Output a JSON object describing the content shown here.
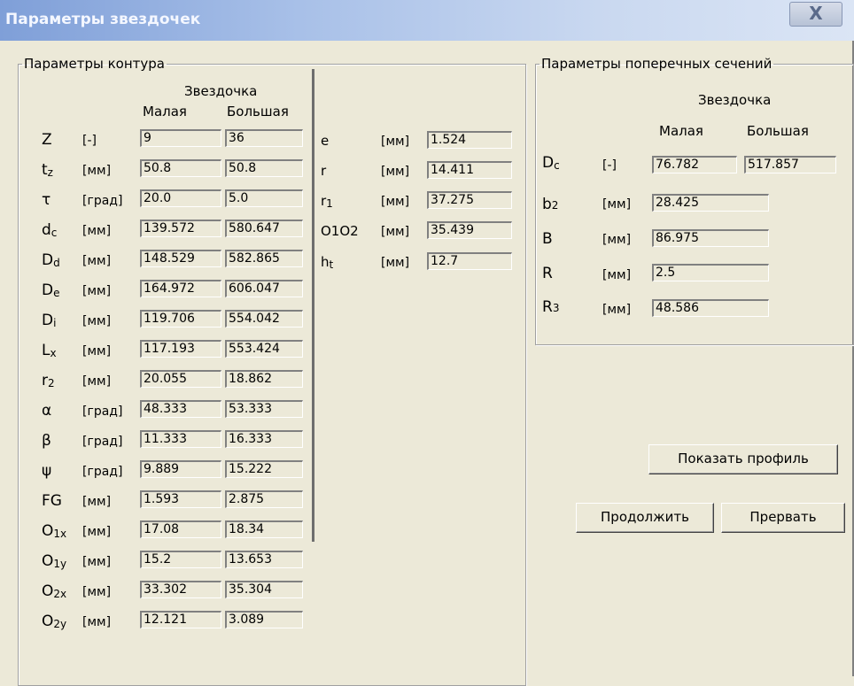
{
  "window": {
    "title": "Параметры звездочек",
    "close_label": "X"
  },
  "contour": {
    "legend": "Параметры контура",
    "header": {
      "group": "Звездочка",
      "small": "Малая",
      "large": "Большая"
    },
    "rows": [
      {
        "sym": "Z",
        "sub": "",
        "unit": "[-]",
        "small": "9",
        "large": "36"
      },
      {
        "sym": "t",
        "sub": "z",
        "unit": "[мм]",
        "small": "50.8",
        "large": "50.8"
      },
      {
        "sym": "τ",
        "sub": "",
        "unit": "[град]",
        "small": "20.0",
        "large": "5.0"
      },
      {
        "sym": "d",
        "sub": "c",
        "unit": "[мм]",
        "small": "139.572",
        "large": "580.647"
      },
      {
        "sym": "D",
        "sub": "d",
        "unit": "[мм]",
        "small": "148.529",
        "large": "582.865"
      },
      {
        "sym": "D",
        "sub": "e",
        "unit": "[мм]",
        "small": "164.972",
        "large": "606.047"
      },
      {
        "sym": "D",
        "sub": "i",
        "unit": "[мм]",
        "small": "119.706",
        "large": "554.042"
      },
      {
        "sym": "L",
        "sub": "x",
        "unit": "[мм]",
        "small": "117.193",
        "large": "553.424"
      },
      {
        "sym": "r",
        "sub": "2",
        "unit": "[мм]",
        "small": "20.055",
        "large": "18.862"
      },
      {
        "sym": "α",
        "sub": "",
        "unit": "[град]",
        "small": "48.333",
        "large": "53.333"
      },
      {
        "sym": "β",
        "sub": "",
        "unit": "[град]",
        "small": "11.333",
        "large": "16.333"
      },
      {
        "sym": "ψ",
        "sub": "",
        "unit": "[град]",
        "small": "9.889",
        "large": "15.222"
      },
      {
        "sym": "FG",
        "sub": "",
        "unit": "[мм]",
        "small": "1.593",
        "large": "2.875"
      },
      {
        "sym": "O",
        "sub": "1x",
        "unit": "[мм]",
        "small": "17.08",
        "large": "18.34"
      },
      {
        "sym": "O",
        "sub": "1y",
        "unit": "[мм]",
        "small": "15.2",
        "large": "13.653"
      },
      {
        "sym": "O",
        "sub": "2x",
        "unit": "[мм]",
        "small": "33.302",
        "large": "35.304"
      },
      {
        "sym": "O",
        "sub": "2y",
        "unit": "[мм]",
        "small": "12.121",
        "large": "3.089"
      }
    ],
    "extra": [
      {
        "sym": "e",
        "sub": "",
        "unit": "[мм]",
        "value": "1.524"
      },
      {
        "sym": "r",
        "sub": "",
        "unit": "[мм]",
        "value": "14.411"
      },
      {
        "sym": "r",
        "sub": "1",
        "unit": "[мм]",
        "value": "37.275"
      },
      {
        "sym": "O1O2",
        "sub": "",
        "unit": "[мм]",
        "value": "35.439"
      },
      {
        "sym": "h",
        "sub": "t",
        "unit": "[мм]",
        "value": "12.7"
      }
    ]
  },
  "sections": {
    "legend": "Параметры поперечных сечений",
    "header": {
      "group": "Звездочка",
      "small": "Малая",
      "large": "Большая"
    },
    "dc": {
      "sym": "D",
      "sub": "c",
      "unit": "[-]",
      "small": "76.782",
      "large": "517.857"
    },
    "b2": {
      "sym": "b",
      "sub": "2",
      "unit": "[мм]",
      "value": "28.425"
    },
    "B": {
      "sym": "B",
      "sub": "",
      "unit": "[мм]",
      "value": "86.975"
    },
    "R": {
      "sym": "R",
      "sub": "",
      "unit": "[мм]",
      "value": "2.5"
    },
    "R3": {
      "sym": "R",
      "sub": "3",
      "unit": "[мм]",
      "value": "48.586"
    }
  },
  "buttons": {
    "show_profile": "Показать профиль",
    "continue": "Продолжить",
    "abort": "Прервать"
  }
}
